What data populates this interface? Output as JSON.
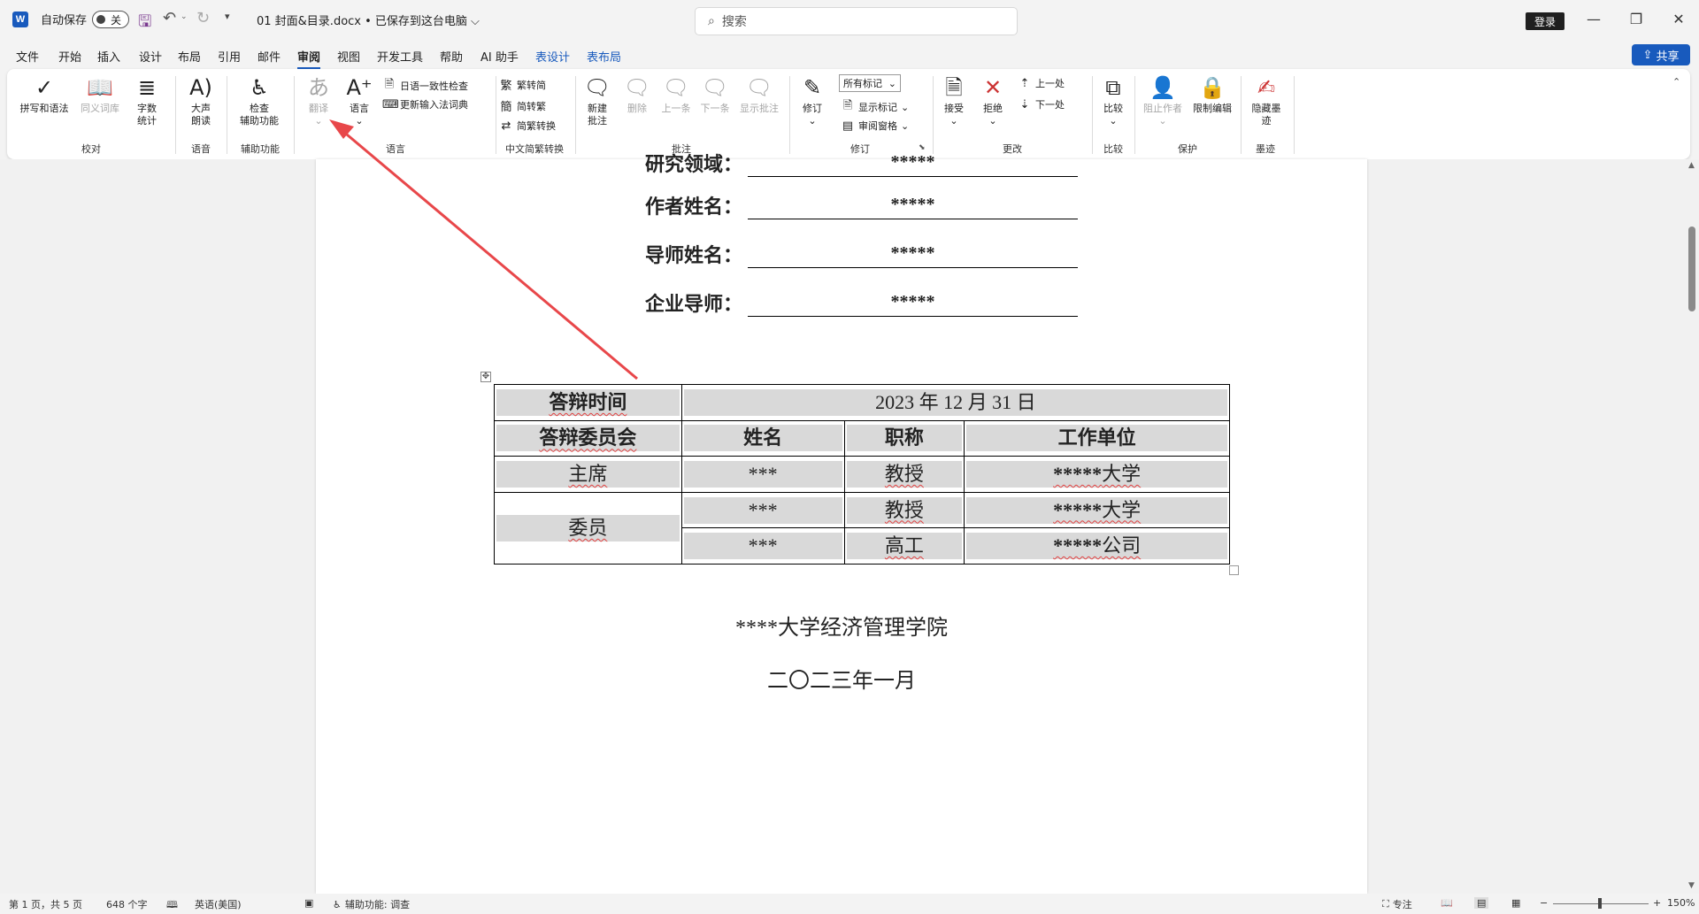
{
  "titlebar": {
    "logo": "W",
    "autosave_label": "自动保存",
    "autosave_state": "关",
    "doc_title": "01 封面&目录.docx • 已保存到这台电脑 ⌵",
    "search_placeholder": "搜索",
    "login": "登录",
    "minimize": "—",
    "maximize": "❐",
    "close": "✕"
  },
  "menu": {
    "items": [
      "文件",
      "开始",
      "插入",
      "设计",
      "布局",
      "引用",
      "邮件",
      "审阅",
      "视图",
      "开发工具",
      "帮助",
      "AI 助手",
      "表设计",
      "表布局"
    ],
    "share": "共享"
  },
  "ribbon": {
    "spelling": "拼写和语法",
    "thesaurus": "同义词库",
    "wordcount_l1": "字数",
    "wordcount_l2": "统计",
    "group_proofing": "校对",
    "readaloud_l1": "大声",
    "readaloud_l2": "朗读",
    "group_speech": "语音",
    "check_l1": "检查",
    "check_l2": "辅助功能",
    "group_accessibility": "辅助功能",
    "translate": "翻译",
    "language": "语言",
    "jp_check": "日语一致性检查",
    "ime_update": "更新输入法词典",
    "group_language": "语言",
    "t2s": "繁转简",
    "s2t": "简转繁",
    "convert": "简繁转换",
    "group_chinese": "中文简繁转换",
    "new_comment_l1": "新建",
    "new_comment_l2": "批注",
    "delete": "删除",
    "prev": "上一条",
    "next": "下一条",
    "show_comments": "显示批注",
    "group_comments": "批注",
    "track": "修订",
    "markup_select": "所有标记",
    "show_markup": "显示标记",
    "review_pane": "审阅窗格",
    "group_tracking": "修订",
    "accept": "接受",
    "reject": "拒绝",
    "prev_change": "上一处",
    "next_change": "下一处",
    "group_changes": "更改",
    "compare": "比较",
    "group_compare": "比较",
    "block_authors": "阻止作者",
    "restrict": "限制编辑",
    "group_protect": "保护",
    "hide_ink_l1": "隐藏墨",
    "hide_ink_l2": "迹",
    "group_ink": "墨迹"
  },
  "document": {
    "fields": [
      {
        "label": "研究领域：",
        "value": "*****"
      },
      {
        "label": "作者姓名：",
        "value": "*****"
      },
      {
        "label": "导师姓名：",
        "value": "*****"
      },
      {
        "label": "企业导师：",
        "value": "*****"
      }
    ],
    "table": {
      "defense_time_label": "答辩时间",
      "defense_time_value": "2023 年 12 月 31 日",
      "committee_label": "答辩委员会",
      "headers": [
        "姓名",
        "职称",
        "工作单位"
      ],
      "chair_label": "主席",
      "chair": {
        "name": "***",
        "title": "教授",
        "unit_stars": "*****",
        "unit_suffix": "大学"
      },
      "member_label": "委员",
      "members": [
        {
          "name": "***",
          "title": "教授",
          "unit_stars": "*****",
          "unit_suffix": "大学"
        },
        {
          "name": "***",
          "title": "高工",
          "unit_stars": "*****",
          "unit_suffix": "公司"
        }
      ]
    },
    "school": "****大学经济管理学院",
    "date": "二〇二三年一月"
  },
  "status": {
    "page": "第 1 页，共 5 页",
    "words": "648 个字",
    "language": "英语(美国)",
    "accessibility": "辅助功能: 调查",
    "focus": "专注",
    "zoom": "150%"
  }
}
